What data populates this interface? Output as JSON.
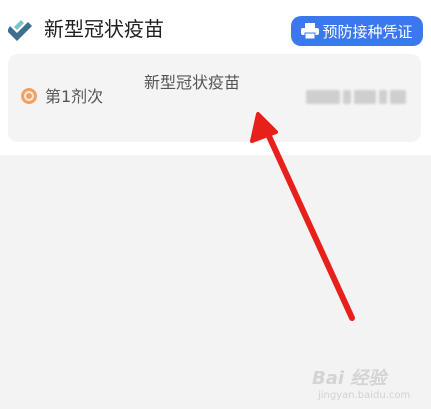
{
  "header": {
    "title": "新型冠状疫苗",
    "certificate_button": "预防接种凭证",
    "icon": "vaccine-icon"
  },
  "dose": {
    "label": "第1剂次",
    "vaccine_name": "新型冠状疫苗",
    "status_color": "#f0a163"
  },
  "watermark": {
    "logo": "Bai 经验",
    "url": "jingyan.baidu.com"
  },
  "colors": {
    "accent": "#3b78f0",
    "annotation_arrow": "#e8201c"
  }
}
